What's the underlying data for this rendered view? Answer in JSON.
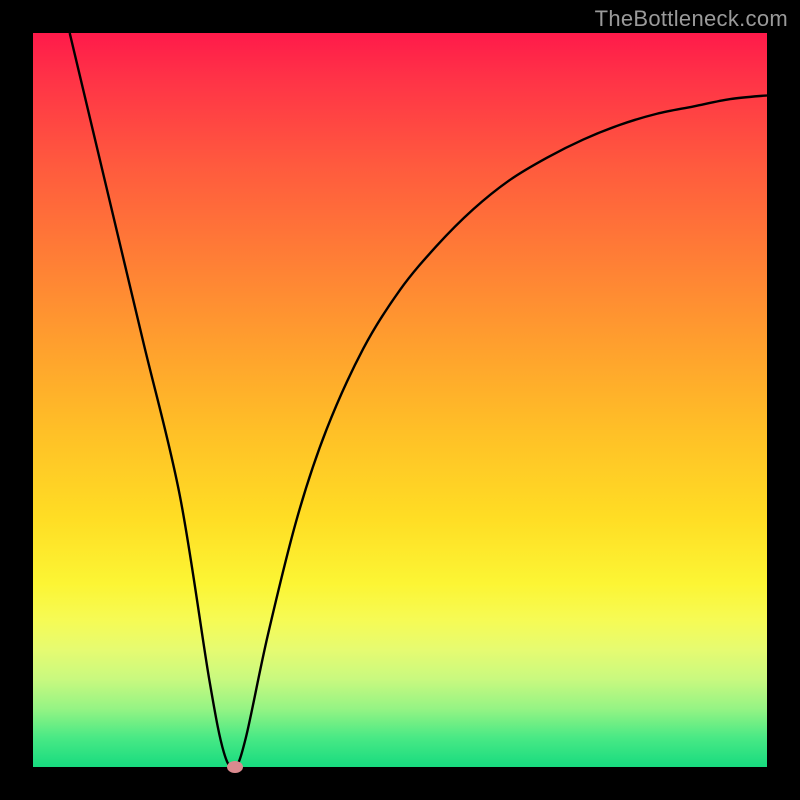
{
  "watermark": "TheBottleneck.com",
  "chart_data": {
    "type": "line",
    "title": "",
    "xlabel": "",
    "ylabel": "",
    "xlim": [
      0,
      100
    ],
    "ylim": [
      0,
      100
    ],
    "series": [
      {
        "name": "curve",
        "x": [
          5,
          10,
          15,
          20,
          24,
          26,
          27.5,
          29,
          32,
          36,
          40,
          45,
          50,
          55,
          60,
          65,
          70,
          75,
          80,
          85,
          90,
          95,
          100
        ],
        "y": [
          100,
          79,
          58,
          37,
          12,
          2,
          0,
          4,
          18,
          34,
          46,
          57,
          65,
          71,
          76,
          80,
          83,
          85.5,
          87.5,
          89,
          90,
          91,
          91.5
        ]
      }
    ],
    "marker": {
      "x": 27.5,
      "y": 0
    },
    "background_gradient": [
      "#ff1a4a",
      "#ff5a3e",
      "#ff9e2e",
      "#ffdd24",
      "#f6fb55",
      "#c9f97f",
      "#49e985",
      "#17db7f"
    ]
  }
}
